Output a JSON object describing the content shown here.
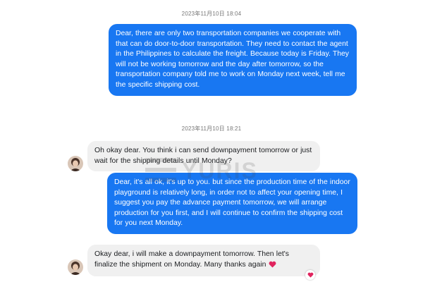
{
  "chat": {
    "timestamps": [
      "2023年11月10日 18:04",
      "2023年11月10日 18:21"
    ],
    "messages": [
      {
        "direction": "outgoing",
        "text": "Dear, there are only two transportation companies we cooperate with that can do door-to-door transportation. They need to contact the agent in the Philippines to calculate the freight. Because today is Friday. They will not be working tomorrow and the day after tomorrow, so the transportation company told me to work on Monday next week, tell me the specific shipping cost."
      },
      {
        "direction": "incoming",
        "text": "Oh okay dear. You think i can send downpayment tomorrow or just wait for the shipping details until Monday?"
      },
      {
        "direction": "outgoing",
        "text": "Dear, it's all ok, it's up to you. but since the production time of the indoor playground is relatively long, in order not to affect your opening time, I suggest you pay the advance payment tomorrow, we will arrange production for you first, and I will continue to confirm the shipping cost for you next Monday."
      },
      {
        "direction": "incoming",
        "text": "Okay dear, i will make a downpayment tomorrow. Then let's finalize the shipment on Monday. Many thanks again",
        "emoji": "heart-icon",
        "reaction": "heart-icon"
      }
    ]
  },
  "watermark": {
    "text": "YURIS"
  },
  "colors": {
    "outgoing_bubble": "#1877f2",
    "incoming_bubble": "#f0f0f0",
    "heart": "#e0245e"
  }
}
